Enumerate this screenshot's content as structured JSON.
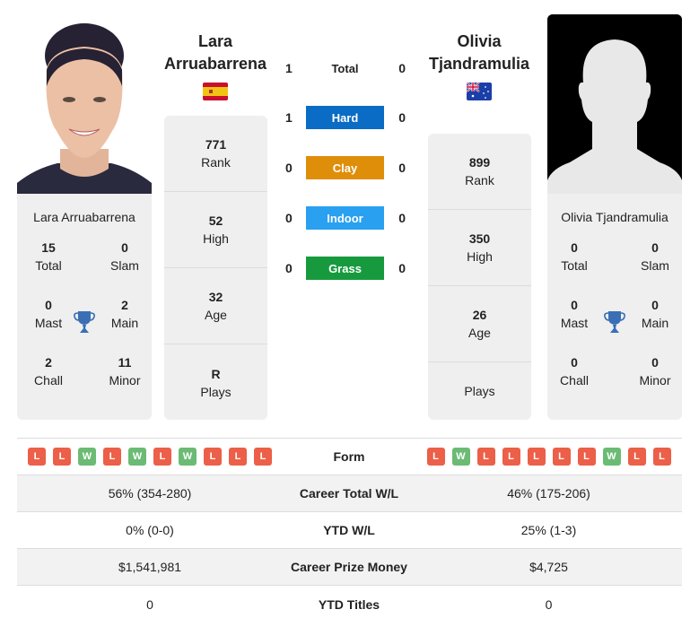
{
  "colors": {
    "hard": "#0a6cc4",
    "clay": "#df8e0a",
    "indoor": "#2aa0f0",
    "grass": "#179a3e",
    "loss": "#ec5f48",
    "win": "#6cbb74",
    "trophy": "#3a6fb5"
  },
  "player1": {
    "name_line1": "Lara",
    "name_line2": "Arruabarrena",
    "full_name": "Lara Arruabarrena",
    "flag": "spain-flag",
    "titles": {
      "total": {
        "value": "15",
        "label": "Total"
      },
      "slam": {
        "value": "0",
        "label": "Slam"
      },
      "mast": {
        "value": "0",
        "label": "Mast"
      },
      "main": {
        "value": "2",
        "label": "Main"
      },
      "chall": {
        "value": "2",
        "label": "Chall"
      },
      "minor": {
        "value": "11",
        "label": "Minor"
      }
    },
    "stats": [
      {
        "value": "771",
        "label": "Rank"
      },
      {
        "value": "52",
        "label": "High"
      },
      {
        "value": "32",
        "label": "Age"
      },
      {
        "value": "R",
        "label": "Plays"
      }
    ],
    "form": [
      "L",
      "L",
      "W",
      "L",
      "W",
      "L",
      "W",
      "L",
      "L",
      "L"
    ],
    "career_wl": "56% (354-280)",
    "ytd_wl": "0% (0-0)",
    "prize_money": "$1,541,981",
    "ytd_titles": "0"
  },
  "player2": {
    "name_line1": "Olivia",
    "name_line2": "Tjandramulia",
    "full_name": "Olivia Tjandramulia",
    "flag": "australia-flag",
    "titles": {
      "total": {
        "value": "0",
        "label": "Total"
      },
      "slam": {
        "value": "0",
        "label": "Slam"
      },
      "mast": {
        "value": "0",
        "label": "Mast"
      },
      "main": {
        "value": "0",
        "label": "Main"
      },
      "chall": {
        "value": "0",
        "label": "Chall"
      },
      "minor": {
        "value": "0",
        "label": "Minor"
      }
    },
    "stats": [
      {
        "value": "899",
        "label": "Rank"
      },
      {
        "value": "350",
        "label": "High"
      },
      {
        "value": "26",
        "label": "Age"
      },
      {
        "value": "",
        "label": "Plays"
      }
    ],
    "form": [
      "L",
      "W",
      "L",
      "L",
      "L",
      "L",
      "L",
      "W",
      "L",
      "L"
    ],
    "career_wl": "46% (175-206)",
    "ytd_wl": "25% (1-3)",
    "prize_money": "$4,725",
    "ytd_titles": "0"
  },
  "h2h": [
    {
      "label": "Total",
      "p1": "1",
      "p2": "0"
    },
    {
      "label": "Hard",
      "p1": "1",
      "p2": "0"
    },
    {
      "label": "Clay",
      "p1": "0",
      "p2": "0"
    },
    {
      "label": "Indoor",
      "p1": "0",
      "p2": "0"
    },
    {
      "label": "Grass",
      "p1": "0",
      "p2": "0"
    }
  ],
  "table": {
    "form_label": "Form",
    "career_wl_label": "Career Total W/L",
    "ytd_wl_label": "YTD W/L",
    "prize_label": "Career Prize Money",
    "ytd_titles_label": "YTD Titles"
  }
}
